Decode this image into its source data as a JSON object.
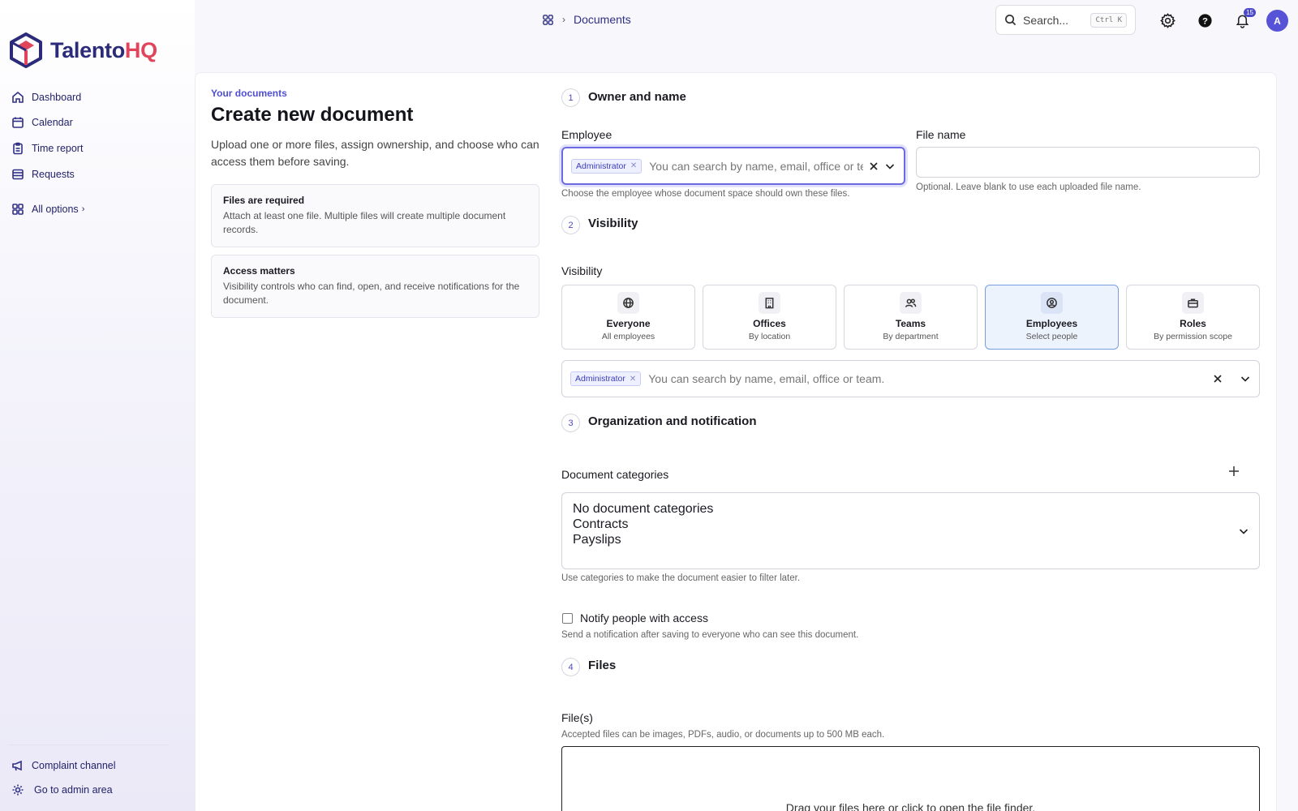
{
  "brand": {
    "part1": "Talento",
    "part2": "HQ",
    "accent": "#e0455c",
    "primary": "#2b2b7a"
  },
  "sidebar": {
    "items": [
      {
        "label": "Dashboard",
        "icon": "home-icon"
      },
      {
        "label": "Calendar",
        "icon": "calendar-icon"
      },
      {
        "label": "Time report",
        "icon": "clipboard-icon"
      },
      {
        "label": "Requests",
        "icon": "list-icon"
      }
    ],
    "all_options": "All options",
    "bottom": [
      {
        "label": "Complaint channel",
        "icon": "megaphone-icon"
      },
      {
        "label": "Go to admin area",
        "icon": "gear-icon"
      }
    ]
  },
  "topbar": {
    "breadcrumb": "Documents",
    "search_placeholder": "Search...",
    "search_shortcut": "Ctrl K",
    "notification_count": "15",
    "avatar_initial": "A"
  },
  "intro": {
    "eyebrow": "Your documents",
    "title": "Create new document",
    "subtitle": "Upload one or more files, assign ownership, and choose who can access them before saving.",
    "boxes": [
      {
        "title": "Files are required",
        "text": "Attach at least one file. Multiple files will create multiple document records."
      },
      {
        "title": "Access matters",
        "text": "Visibility controls who can find, open, and receive notifications for the document."
      }
    ]
  },
  "steps": [
    {
      "num": "1",
      "title": "Owner and name"
    },
    {
      "num": "2",
      "title": "Visibility"
    },
    {
      "num": "3",
      "title": "Organization and notification"
    },
    {
      "num": "4",
      "title": "Files"
    }
  ],
  "owner": {
    "employee_label": "Employee",
    "employee_tag": "Administrator",
    "employee_placeholder": "You can search by name, email, office or team.",
    "employee_hint": "Choose the employee whose document space should own these files.",
    "filename_label": "File name",
    "filename_value": "",
    "filename_hint": "Optional. Leave blank to use each uploaded file name."
  },
  "visibility": {
    "label": "Visibility",
    "options": [
      {
        "title": "Everyone",
        "sub": "All employees",
        "icon": "globe-icon",
        "selected": false
      },
      {
        "title": "Offices",
        "sub": "By location",
        "icon": "building-icon",
        "selected": false
      },
      {
        "title": "Teams",
        "sub": "By department",
        "icon": "users-icon",
        "selected": false
      },
      {
        "title": "Employees",
        "sub": "Select people",
        "icon": "user-circle-icon",
        "selected": true
      },
      {
        "title": "Roles",
        "sub": "By permission scope",
        "icon": "briefcase-icon",
        "selected": false
      }
    ],
    "tag": "Administrator",
    "placeholder": "You can search by name, email, office or team."
  },
  "organization": {
    "categories_label": "Document categories",
    "categories": [
      "No document categories",
      "Contracts",
      "Payslips"
    ],
    "categories_hint": "Use categories to make the document easier to filter later.",
    "notify_label": "Notify people with access",
    "notify_checked": false,
    "notify_hint": "Send a notification after saving to everyone who can see this document."
  },
  "files": {
    "label": "File(s)",
    "hint": "Accepted files can be images, PDFs, audio, or documents up to 500 MB each.",
    "dropzone_text": "Drag your files here or click to open the file finder."
  }
}
